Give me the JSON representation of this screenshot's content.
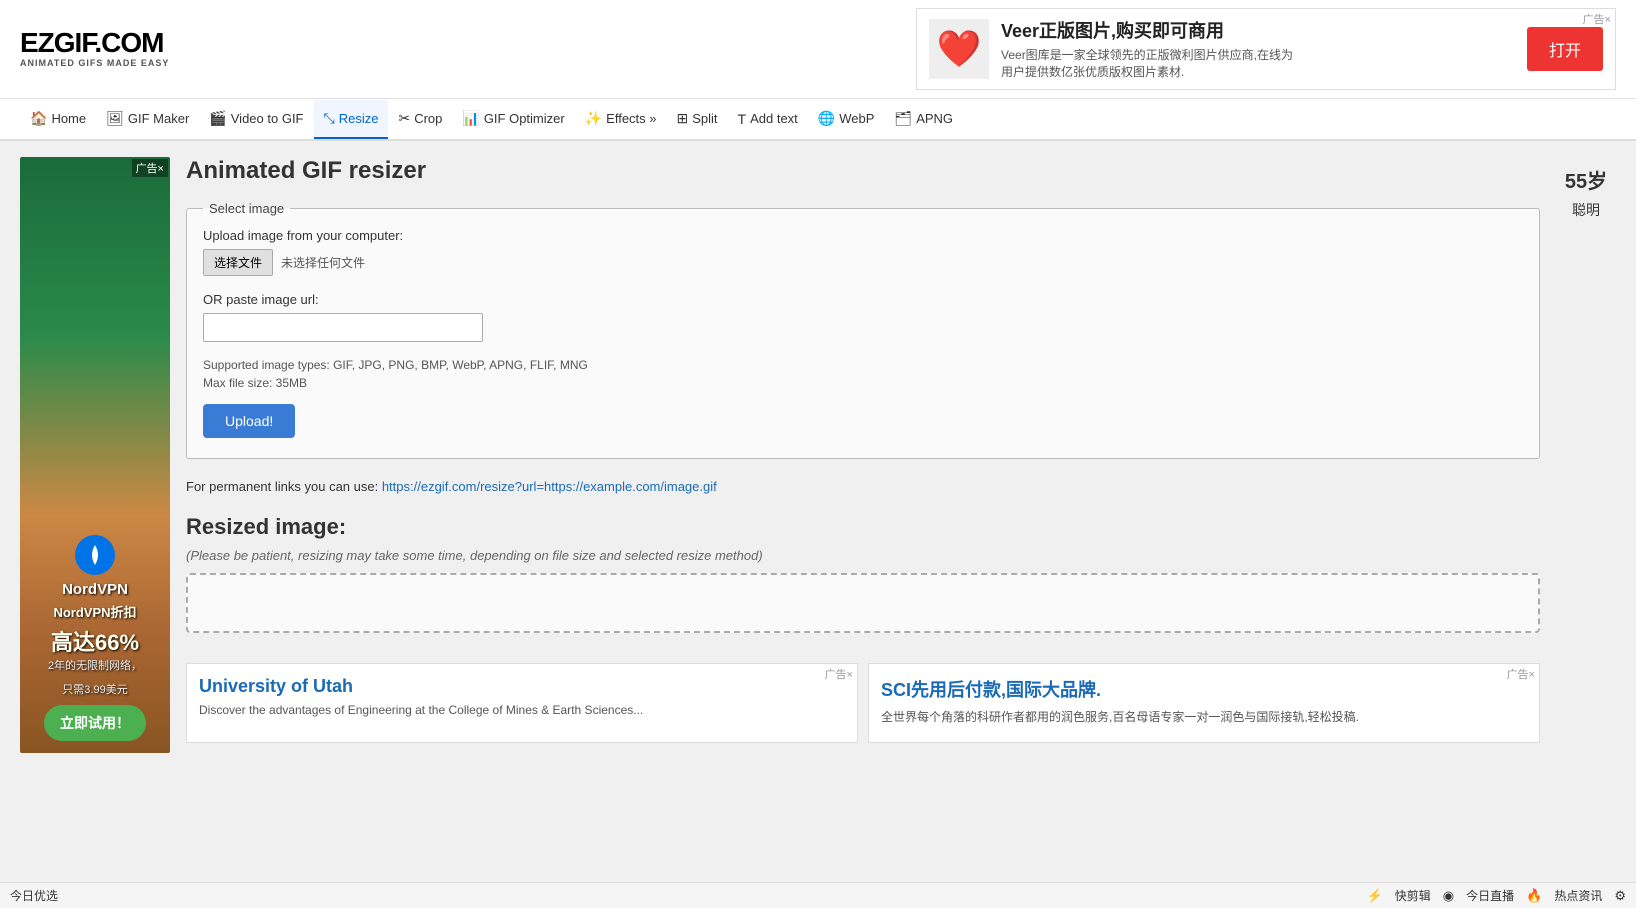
{
  "brand": {
    "name": "EZGIF.COM",
    "sub": "ANIMATED GIFS MADE EASY"
  },
  "topAd": {
    "close_label": "广告×",
    "title": "Veer正版图片,购买即可商用",
    "desc1": "Veer图库是一家全球领先的正版微利图片供应商,在线为",
    "desc2": "用户提供数亿张优质版权图片素材.",
    "cta": "打开"
  },
  "nav": {
    "items": [
      {
        "id": "home",
        "label": "Home",
        "icon": "🏠",
        "active": false
      },
      {
        "id": "gif-maker",
        "label": "GIF Maker",
        "icon": "🖼",
        "active": false
      },
      {
        "id": "video-to-gif",
        "label": "Video to GIF",
        "icon": "🎬",
        "active": false
      },
      {
        "id": "resize",
        "label": "Resize",
        "icon": "⤡",
        "active": true
      },
      {
        "id": "crop",
        "label": "Crop",
        "icon": "✂",
        "active": false
      },
      {
        "id": "gif-optimizer",
        "label": "GIF Optimizer",
        "icon": "📊",
        "active": false
      },
      {
        "id": "effects",
        "label": "Effects »",
        "icon": "✨",
        "active": false
      },
      {
        "id": "split",
        "label": "Split",
        "icon": "⊞",
        "active": false
      },
      {
        "id": "add-text",
        "label": "Add text",
        "icon": "T",
        "active": false
      },
      {
        "id": "webp",
        "label": "WebP",
        "icon": "🌐",
        "active": false
      },
      {
        "id": "apng",
        "label": "APNG",
        "icon": "🗂",
        "active": false
      }
    ]
  },
  "sidebarAd": {
    "close_label": "广告×",
    "brand": "NordVPN",
    "tagline": "NordVPN折扣",
    "percent": "高达66%",
    "detail1": "2年的无限制网络，",
    "detail2": "只需3.99美元",
    "cta": "立即试用！"
  },
  "main": {
    "page_title": "Animated GIF resizer",
    "upload_section_legend": "Select image",
    "upload_label": "Upload image from your computer:",
    "file_button_label": "选择文件",
    "file_status": "未选择任何文件",
    "url_label": "OR paste image url:",
    "url_placeholder": "",
    "supported_label": "Supported image types: GIF, JPG, PNG, BMP, WebP, APNG, FLIF, MNG",
    "max_size_label": "Max file size: 35MB",
    "upload_btn_label": "Upload!",
    "perm_link_prefix": "For permanent links you can use: ",
    "perm_link_url": "https://ezgif.com/resize?url=",
    "perm_link_example": "https://example.com/image.gif",
    "resized_title": "Resized image:",
    "resized_note": "(Please be patient, resizing may take some time, depending on file size and selected resize method)"
  },
  "bottomAds": [
    {
      "id": "univ-utah",
      "close_label": "广告×",
      "title": "University of Utah",
      "desc": "Discover the advantages of Engineering at the College of Mines & Earth Sciences..."
    },
    {
      "id": "sci",
      "close_label": "广告×",
      "title": "SCI先用后付款,国际大品牌.",
      "desc": "全世界每个角落的科研作者都用的润色服务,百名母语专家一对一润色与国际接轨,轻松投稿."
    }
  ],
  "rightAd": {
    "age": "55岁",
    "text": "聪明"
  },
  "statusBar": {
    "left_label": "今日优选",
    "icons": [
      "⚡",
      "◉",
      "🔥"
    ],
    "labels": [
      "快剪辑",
      "今日直播",
      "热点资讯"
    ],
    "right_icon": "⚙"
  }
}
